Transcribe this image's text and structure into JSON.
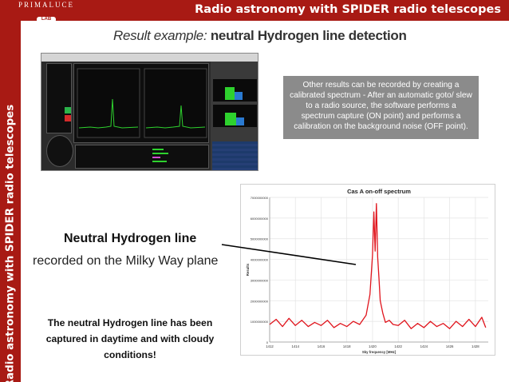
{
  "brand": {
    "name": "PRIMALUCE",
    "sub": "LAB"
  },
  "banner": {
    "title": "Radio astronomy with SPIDER radio telescopes"
  },
  "sidebar": {
    "title": "Radio astronomy with SPIDER radio telescopes"
  },
  "subtitle": {
    "prefix": "Result example:",
    "main": "neutral Hydrogen line detection"
  },
  "info_box": {
    "text": "Other results can be recorded by creating a calibrated spectrum - After an automatic goto/ slew to a radio source, the software performs a spectrum capture (ON point) and performs a calibration on the background noise (OFF point)."
  },
  "hydrogen": {
    "title": "Neutral Hydrogen line",
    "subtitle": "recorded on the Milky Way plane"
  },
  "note": {
    "text": "The neutral Hydrogen line has been captured in daytime and with cloudy conditions!"
  },
  "colors": {
    "accent": "#a81a14",
    "spectrum": "#e0141c",
    "info_box": "#8b8b8b"
  },
  "chart_data": {
    "type": "line",
    "title": "Cas A on-off spectrum",
    "xlabel": "Sky frequency [MHz]",
    "ylabel": "Results",
    "xlim": [
      1412,
      1429
    ],
    "ylim": [
      0,
      7000000000
    ],
    "x_ticks": [
      "1412",
      "1414",
      "1416",
      "1418",
      "1420",
      "1422",
      "1424",
      "1426",
      "1428"
    ],
    "y_ticks": [
      "0",
      "1000000000",
      "2000000000",
      "3000000000",
      "4000000000",
      "5000000000",
      "6000000000",
      "7000000000"
    ],
    "grid": true,
    "series": [
      {
        "x": [
          1412.0,
          1412.5,
          1413.0,
          1413.5,
          1414.0,
          1414.5,
          1415.0,
          1415.5,
          1416.0,
          1416.5,
          1417.0,
          1417.5,
          1418.0,
          1418.5,
          1419.0,
          1419.5,
          1419.8,
          1420.0,
          1420.1,
          1420.2,
          1420.3,
          1420.4,
          1420.5,
          1420.6,
          1420.8,
          1421.0,
          1421.3,
          1421.6,
          1422.0,
          1422.5,
          1423.0,
          1423.5,
          1424.0,
          1424.5,
          1425.0,
          1425.5,
          1426.0,
          1426.5,
          1427.0,
          1427.5,
          1428.0,
          1428.5,
          1428.8
        ],
        "y": [
          850000000,
          1100000000,
          750000000,
          1150000000,
          800000000,
          1050000000,
          750000000,
          950000000,
          800000000,
          1050000000,
          700000000,
          900000000,
          750000000,
          1000000000,
          850000000,
          1300000000,
          2300000000,
          4200000000,
          6300000000,
          4400000000,
          6700000000,
          4100000000,
          3100000000,
          2000000000,
          1400000000,
          950000000,
          1050000000,
          850000000,
          800000000,
          1050000000,
          650000000,
          900000000,
          700000000,
          1000000000,
          750000000,
          900000000,
          650000000,
          1000000000,
          750000000,
          1100000000,
          750000000,
          1200000000,
          700000000
        ]
      }
    ]
  }
}
